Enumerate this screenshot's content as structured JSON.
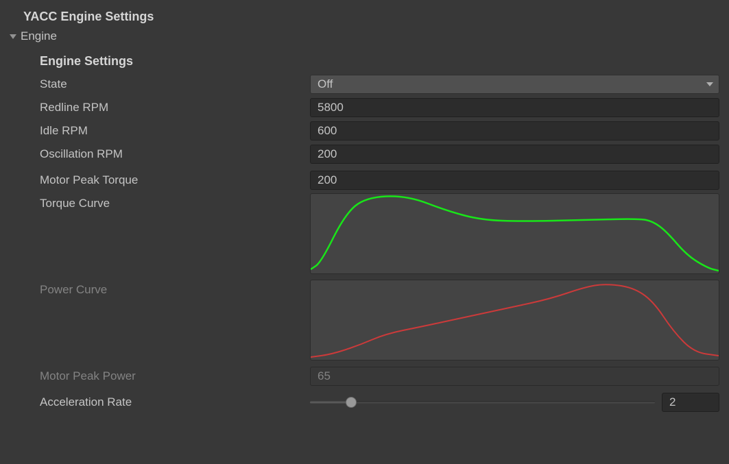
{
  "componentTitle": "YACC Engine Settings",
  "section": {
    "name": "Engine"
  },
  "heading": "Engine Settings",
  "fields": {
    "stateLabel": "State",
    "stateValue": "Off",
    "redlineLabel": "Redline RPM",
    "redlineValue": "5800",
    "idleLabel": "Idle RPM",
    "idleValue": "600",
    "oscillationLabel": "Oscillation RPM",
    "oscillationValue": "200",
    "peakTorqueLabel": "Motor Peak Torque",
    "peakTorqueValue": "200",
    "torqueCurveLabel": "Torque Curve",
    "powerCurveLabel": "Power Curve",
    "peakPowerLabel": "Motor Peak Power",
    "peakPowerValue": "65",
    "accelLabel": "Acceleration Rate",
    "accelValue": "2"
  },
  "slider": {
    "min": 0,
    "max": 20,
    "value": 2,
    "percent": 12
  },
  "curves": {
    "torque": {
      "color": "#19e619",
      "points": [
        [
          0,
          110
        ],
        [
          15,
          100
        ],
        [
          50,
          30
        ],
        [
          80,
          5
        ],
        [
          140,
          2
        ],
        [
          200,
          25
        ],
        [
          250,
          38
        ],
        [
          310,
          40
        ],
        [
          400,
          38
        ],
        [
          480,
          36
        ],
        [
          500,
          40
        ],
        [
          520,
          55
        ],
        [
          550,
          90
        ],
        [
          580,
          108
        ],
        [
          596,
          112
        ]
      ]
    },
    "power": {
      "color": "#cc3a3a",
      "points": [
        [
          0,
          112
        ],
        [
          30,
          108
        ],
        [
          70,
          95
        ],
        [
          110,
          78
        ],
        [
          160,
          68
        ],
        [
          220,
          55
        ],
        [
          290,
          40
        ],
        [
          350,
          27
        ],
        [
          400,
          10
        ],
        [
          430,
          5
        ],
        [
          470,
          10
        ],
        [
          500,
          30
        ],
        [
          530,
          75
        ],
        [
          560,
          105
        ],
        [
          596,
          110
        ]
      ]
    }
  }
}
